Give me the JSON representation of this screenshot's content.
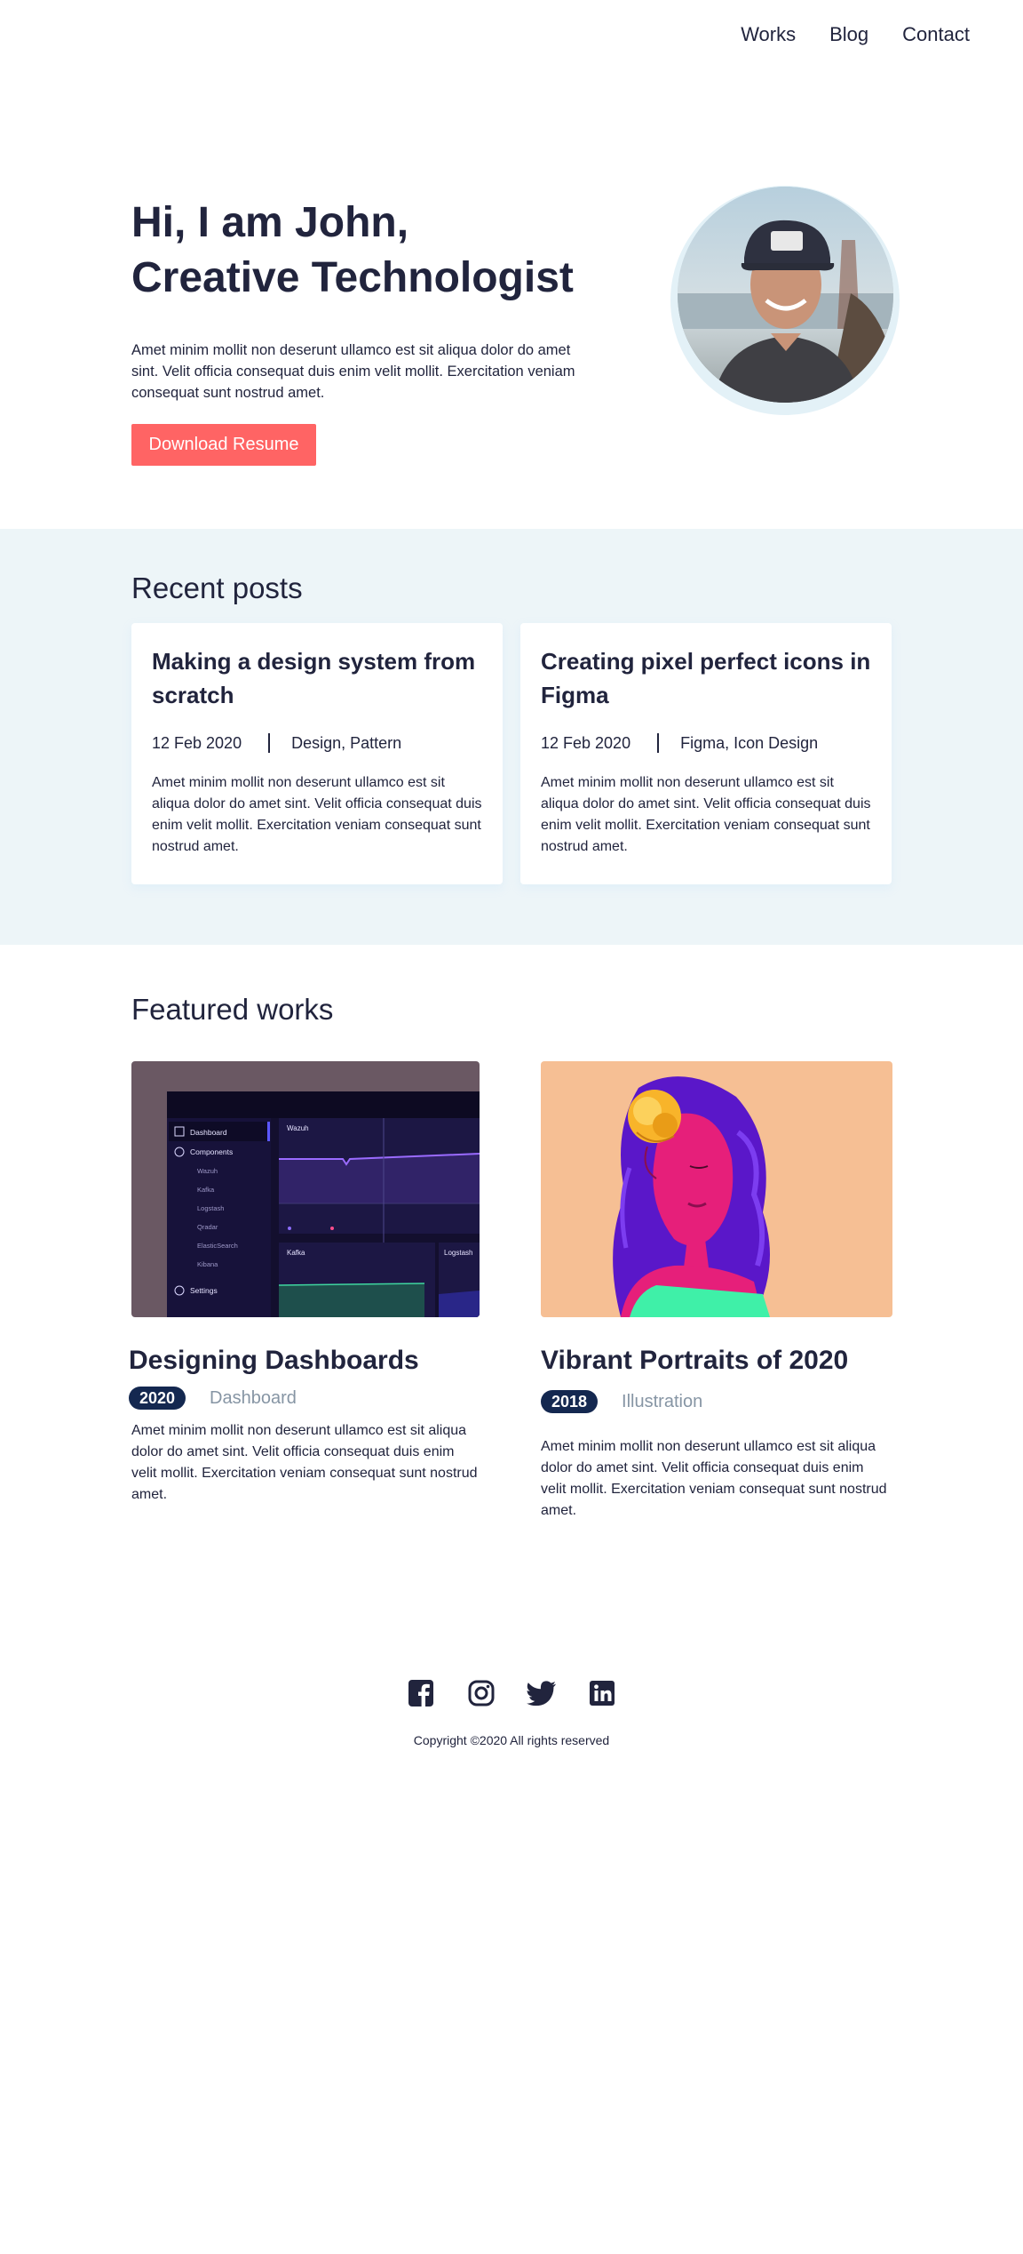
{
  "nav": {
    "items": [
      {
        "label": "Works"
      },
      {
        "label": "Blog"
      },
      {
        "label": "Contact"
      }
    ]
  },
  "hero": {
    "title_line1": "Hi, I am John,",
    "title_line2": "Creative Technologist",
    "description": "Amet minim mollit non deserunt ullamco est sit aliqua dolor do amet sint. Velit officia consequat duis enim velit mollit. Exercitation veniam consequat sunt nostrud amet.",
    "button_label": "Download Resume"
  },
  "recent_posts": {
    "title": "Recent posts",
    "posts": [
      {
        "title": "Making a design system from scratch",
        "date": "12 Feb 2020",
        "tags": "Design, Pattern",
        "description": "Amet minim mollit non deserunt ullamco est sit aliqua dolor do amet sint. Velit officia consequat duis enim velit mollit. Exercitation veniam consequat sunt nostrud amet."
      },
      {
        "title": "Creating pixel perfect icons in Figma",
        "date": "12 Feb 2020",
        "tags": "Figma, Icon Design",
        "description": "Amet minim mollit non deserunt ullamco est sit aliqua dolor do amet sint. Velit officia consequat duis enim velit mollit. Exercitation veniam consequat sunt nostrud amet."
      }
    ]
  },
  "featured_works": {
    "title": "Featured works",
    "works": [
      {
        "title": "Designing Dashboards",
        "year": "2020",
        "category": "Dashboard",
        "description": "Amet minim mollit non deserunt ullamco est sit aliqua dolor do amet sint. Velit officia consequat duis enim velit mollit. Exercitation veniam consequat sunt nostrud amet."
      },
      {
        "title": "Vibrant Portraits of 2020",
        "year": "2018",
        "category": "Illustration",
        "description": "Amet minim mollit non deserunt ullamco est sit aliqua dolor do amet sint. Velit officia consequat duis enim velit mollit. Exercitation veniam consequat sunt nostrud amet."
      }
    ]
  },
  "dashboard_thumb": {
    "menu": [
      "Dashboard",
      "Components",
      "Wazuh",
      "Kafka",
      "Logstash",
      "Qradar",
      "ElasticSearch",
      "Kibana",
      "Settings"
    ],
    "panel_title": "Wazuh",
    "panel2_title": "Kafka",
    "panel3_title": "Logstash"
  },
  "footer": {
    "social_icons": [
      "facebook-icon",
      "instagram-icon",
      "twitter-icon",
      "linkedin-icon"
    ],
    "copyright": "Copyright ©2020 All rights reserved"
  },
  "colors": {
    "text": "#21243d",
    "accent": "#ff6464",
    "badge": "#142850",
    "muted": "#8695a4",
    "section_bg": "#edf5f8"
  }
}
